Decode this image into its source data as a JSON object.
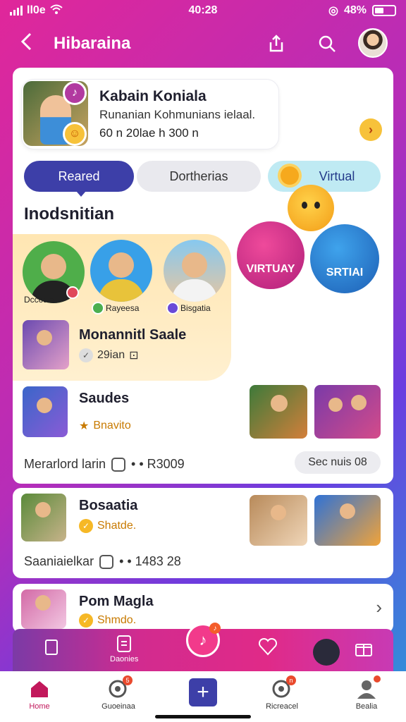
{
  "status": {
    "time": "40:28",
    "carrier": "ll0e",
    "battery": "48%",
    "battery_level": 0.48
  },
  "header": {
    "back_icon": "back-arrow-icon",
    "title": "Hibaraina"
  },
  "profile": {
    "name": "Kabain Koniala",
    "subtitle": "Runanian Kohmunians ielaal.",
    "stats": "60 n 20lae h 300 n"
  },
  "tabs": [
    {
      "label": "Reared",
      "active": true
    },
    {
      "label": "Dortherias",
      "active": false
    },
    {
      "label": "Virtual",
      "active": false
    }
  ],
  "section": {
    "title": "Inodsnitian"
  },
  "featured": {
    "circle_labels": [
      "Dccoalo",
      "Rayeesa",
      "Bisgatia"
    ],
    "row_title": "Monannitl Saale",
    "row_meta": "29ian"
  },
  "characters": {
    "left_label": "VIRTUAY",
    "right_label": "SRTIAI"
  },
  "posts": [
    {
      "title": "Saudes",
      "meta": "Bnavito",
      "footer": "Merarlord larin",
      "footer_meta": "• • R3009",
      "chip": "Sec nuis 08"
    },
    {
      "title": "Bosaatia",
      "meta": "Shatde.",
      "footer": "Saaniaielkar",
      "footer_meta": "• • 1483 28"
    },
    {
      "title": "Pom Magla",
      "meta": "Shmdo."
    }
  ],
  "bottom_tab": {
    "item_label": "Daonies"
  },
  "nav": [
    {
      "label": "Home",
      "icon": "home-icon",
      "active": true
    },
    {
      "label": "Guoeinaa",
      "icon": "chat-icon",
      "badge": "5"
    },
    {
      "label": "",
      "icon": "plus-icon"
    },
    {
      "label": "Ricreacel",
      "icon": "chat-icon",
      "badge": "n"
    },
    {
      "label": "Bealia",
      "icon": "profile-icon"
    }
  ],
  "colors": {
    "accent": "#3d3fa8",
    "brand_pink": "#e0279a",
    "card": "#ffffff"
  }
}
